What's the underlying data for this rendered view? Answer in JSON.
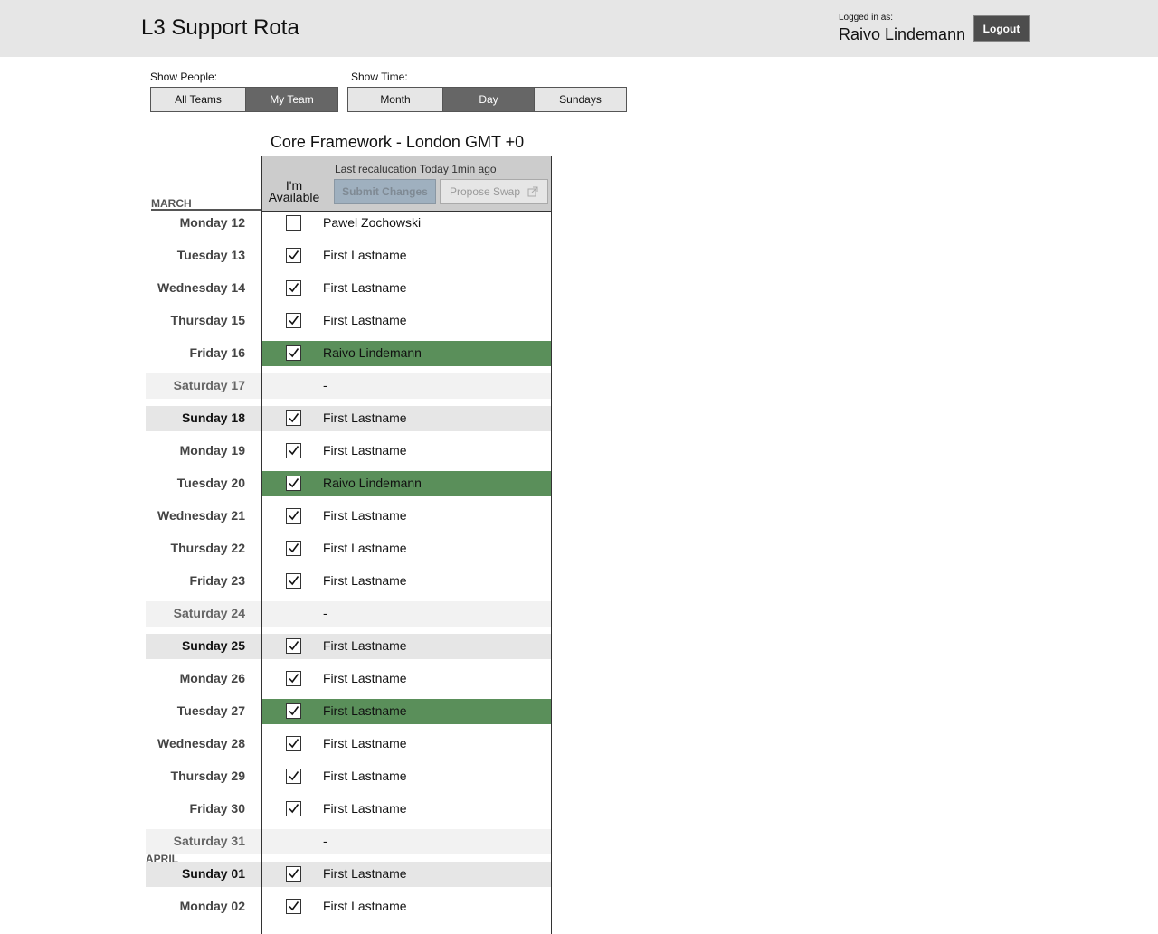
{
  "header": {
    "title": "L3 Support Rota",
    "logged_in_label": "Logged in as:",
    "user_name": "Raivo Lindemann",
    "logout_label": "Logout"
  },
  "filters": {
    "people": {
      "label": "Show People:",
      "options": [
        {
          "label": "All Teams",
          "active": false
        },
        {
          "label": "My Team",
          "active": true
        }
      ]
    },
    "time": {
      "label": "Show Time:",
      "options": [
        {
          "label": "Month",
          "active": false
        },
        {
          "label": "Day",
          "active": true
        },
        {
          "label": "Sundays",
          "active": false
        }
      ]
    }
  },
  "team": {
    "title": "Core Framework - London GMT +0",
    "recalc_text": "Last recalucation Today 1min ago",
    "available_label": "I'm Available",
    "submit_label": "Submit Changes",
    "swap_label": "Propose Swap"
  },
  "months": [
    "MARCH",
    "APRIL"
  ],
  "rows": [
    {
      "day": "Monday 12",
      "type": "weekday",
      "checked": false,
      "assignee": "Pawel Zochowski",
      "mine": false
    },
    {
      "day": "Tuesday 13",
      "type": "weekday",
      "checked": true,
      "assignee": "First Lastname",
      "mine": false
    },
    {
      "day": "Wednesday 14",
      "type": "weekday",
      "checked": true,
      "assignee": "First Lastname",
      "mine": false
    },
    {
      "day": "Thursday 15",
      "type": "weekday",
      "checked": true,
      "assignee": "First Lastname",
      "mine": false
    },
    {
      "day": "Friday 16",
      "type": "weekday",
      "checked": true,
      "assignee": "Raivo Lindemann",
      "mine": true
    },
    {
      "day": "Saturday 17",
      "type": "saturday",
      "checked": null,
      "assignee": "-",
      "mine": false
    },
    {
      "day": "Sunday 18",
      "type": "sunday",
      "checked": true,
      "assignee": "First Lastname",
      "mine": false
    },
    {
      "day": "Monday 19",
      "type": "weekday",
      "checked": true,
      "assignee": "First Lastname",
      "mine": false
    },
    {
      "day": "Tuesday 20",
      "type": "weekday",
      "checked": true,
      "assignee": "Raivo Lindemann",
      "mine": true
    },
    {
      "day": "Wednesday 21",
      "type": "weekday",
      "checked": true,
      "assignee": "First Lastname",
      "mine": false
    },
    {
      "day": "Thursday 22",
      "type": "weekday",
      "checked": true,
      "assignee": "First Lastname",
      "mine": false
    },
    {
      "day": "Friday 23",
      "type": "weekday",
      "checked": true,
      "assignee": "First Lastname",
      "mine": false
    },
    {
      "day": "Saturday 24",
      "type": "saturday",
      "checked": null,
      "assignee": "-",
      "mine": false
    },
    {
      "day": "Sunday 25",
      "type": "sunday",
      "checked": true,
      "assignee": "First Lastname",
      "mine": false
    },
    {
      "day": "Monday 26",
      "type": "weekday",
      "checked": true,
      "assignee": "First Lastname",
      "mine": false
    },
    {
      "day": "Tuesday 27",
      "type": "weekday",
      "checked": true,
      "assignee": "First Lastname",
      "mine": true
    },
    {
      "day": "Wednesday 28",
      "type": "weekday",
      "checked": true,
      "assignee": "First Lastname",
      "mine": false
    },
    {
      "day": "Thursday 29",
      "type": "weekday",
      "checked": true,
      "assignee": "First Lastname",
      "mine": false
    },
    {
      "day": "Friday 30",
      "type": "weekday",
      "checked": true,
      "assignee": "First Lastname",
      "mine": false
    },
    {
      "day": "Saturday 31",
      "type": "saturday",
      "checked": null,
      "assignee": "-",
      "mine": false
    },
    {
      "day": "Sunday 01",
      "type": "sunday",
      "checked": true,
      "assignee": "First Lastname",
      "mine": false
    },
    {
      "day": "Monday 02",
      "type": "weekday",
      "checked": true,
      "assignee": "First Lastname",
      "mine": false
    }
  ],
  "colors": {
    "mine_highlight": "#5a8f5a",
    "active_segment": "#666666",
    "saturday_bg": "#f2f2f2",
    "sunday_bg": "#e6e6e6"
  }
}
